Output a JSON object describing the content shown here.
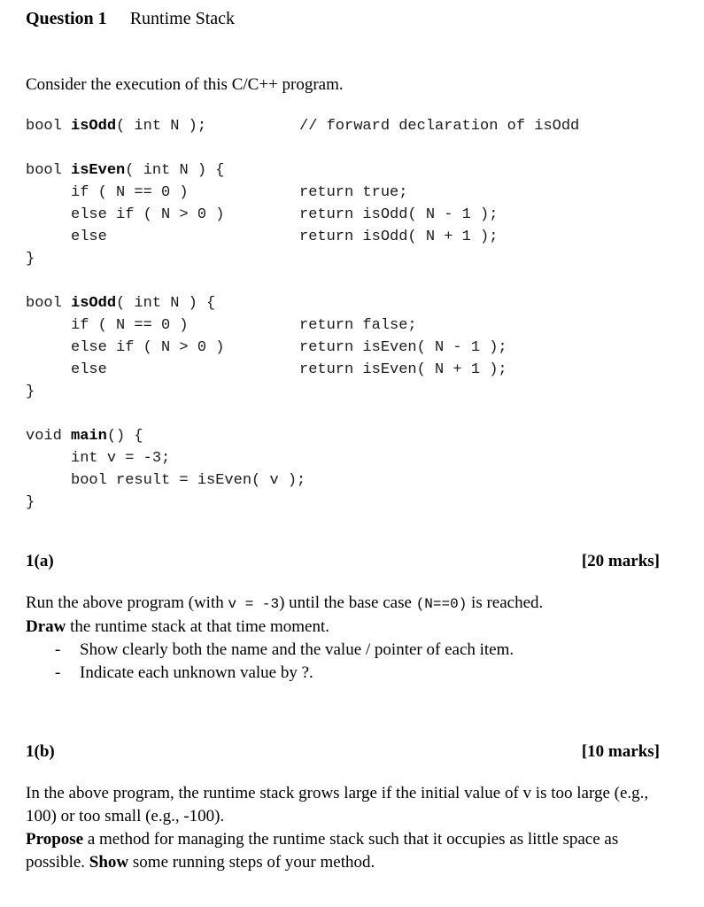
{
  "heading": {
    "label": "Question 1",
    "title": "Runtime Stack"
  },
  "intro": "Consider the execution of this C/C++ program.",
  "code": {
    "lines": [
      {
        "left_plain1": "bool ",
        "bold": "isOdd",
        "left_plain2": "( int N );",
        "right": "// forward declaration of isOdd"
      },
      {
        "blank": true
      },
      {
        "left_plain1": "bool ",
        "bold": "isEven",
        "left_plain2": "( int N ) {",
        "right": ""
      },
      {
        "left_plain1": "     if ( N == 0 )",
        "bold": "",
        "left_plain2": "",
        "right": "return true;"
      },
      {
        "left_plain1": "     else if ( N > 0 )",
        "bold": "",
        "left_plain2": "",
        "right": "return isOdd( N - 1 );"
      },
      {
        "left_plain1": "     else",
        "bold": "",
        "left_plain2": "",
        "right": "return isOdd( N + 1 );"
      },
      {
        "left_plain1": "}",
        "bold": "",
        "left_plain2": "",
        "right": ""
      },
      {
        "blank": true
      },
      {
        "left_plain1": "bool ",
        "bold": "isOdd",
        "left_plain2": "( int N ) {",
        "right": ""
      },
      {
        "left_plain1": "     if ( N == 0 )",
        "bold": "",
        "left_plain2": "",
        "right": "return false;"
      },
      {
        "left_plain1": "     else if ( N > 0 )",
        "bold": "",
        "left_plain2": "",
        "right": "return isEven( N - 1 );"
      },
      {
        "left_plain1": "     else",
        "bold": "",
        "left_plain2": "",
        "right": "return isEven( N + 1 );"
      },
      {
        "left_plain1": "}",
        "bold": "",
        "left_plain2": "",
        "right": ""
      },
      {
        "blank": true
      },
      {
        "left_plain1": "void ",
        "bold": "main",
        "left_plain2": "() {",
        "right": ""
      },
      {
        "left_plain1": "     int v = -3;",
        "bold": "",
        "left_plain2": "",
        "right": ""
      },
      {
        "left_plain1": "     bool result = isEven( v );",
        "bold": "",
        "left_plain2": "",
        "right": ""
      },
      {
        "left_plain1": "}",
        "bold": "",
        "left_plain2": "",
        "right": ""
      }
    ]
  },
  "part_a": {
    "label": "1(a)",
    "marks": "[20 marks]",
    "line1_pre": "Run the above program (with ",
    "line1_mono1": "v  =  -3",
    "line1_mid": ") until the base case ",
    "line1_mono2": "(N==0)",
    "line1_post": " is reached.",
    "line2_bold": "Draw",
    "line2_rest": " the runtime stack at that time moment.",
    "bullet_marker": "-",
    "bullets": [
      "Show clearly both the name and  the value / pointer of each item.",
      "Indicate each unknown value by ?."
    ]
  },
  "part_b": {
    "label": "1(b)",
    "marks": "[10 marks]",
    "para1": "In the above program, the runtime stack grows large if the initial value of v is too large (e.g., 100) or too small (e.g., -100).",
    "para2_bold1": "Propose",
    "para2_mid": " a method for managing the runtime stack such that it occupies as little space as possible. ",
    "para2_bold2": "Show",
    "para2_end": " some running steps of your method."
  }
}
